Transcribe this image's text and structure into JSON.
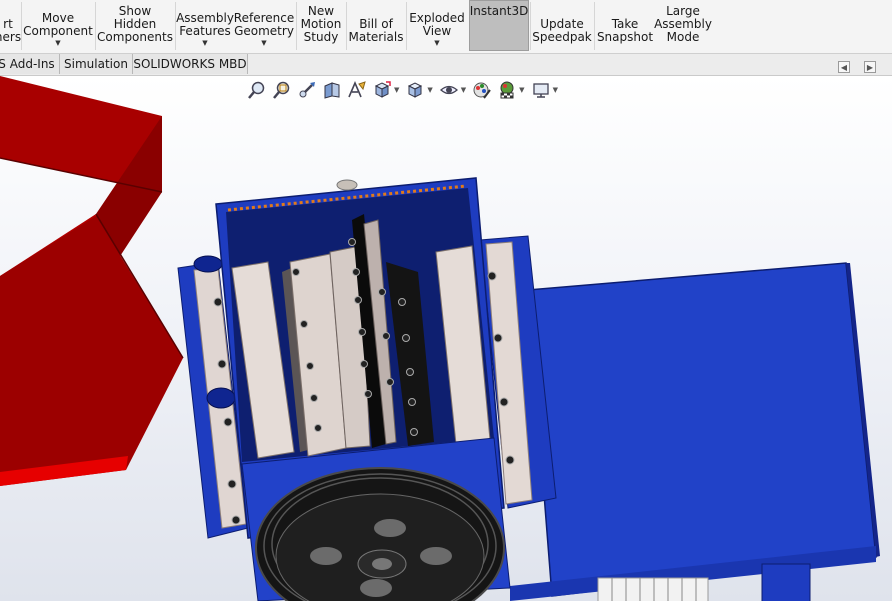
{
  "ribbon": {
    "items": [
      {
        "label_lines": [
          "rt",
          "ners"
        ]
      },
      {
        "label_lines": [
          "Move",
          "Component"
        ],
        "dropdown": true
      },
      {
        "label_lines": [
          "Show",
          "Hidden",
          "Components"
        ]
      },
      {
        "label_lines": [
          "Assembly",
          "Features"
        ],
        "dropdown": true
      },
      {
        "label_lines": [
          "Reference",
          "Geometry"
        ],
        "dropdown": true
      },
      {
        "label_lines": [
          "New",
          "Motion",
          "Study"
        ]
      },
      {
        "label_lines": [
          "Bill of",
          "Materials"
        ]
      },
      {
        "label_lines": [
          "Exploded",
          "View"
        ],
        "dropdown": true
      },
      {
        "label_lines": [
          "Instant3D"
        ],
        "active": true
      },
      {
        "label_lines": [
          "Update",
          "Speedpak"
        ]
      },
      {
        "label_lines": [
          "Take",
          "Snapshot"
        ]
      },
      {
        "label_lines": [
          "Large",
          "Assembly",
          "Mode"
        ]
      }
    ]
  },
  "tabs": [
    "S Add-Ins",
    "Simulation",
    "SOLIDWORKS MBD"
  ],
  "hud_icons": [
    "zoom-to-fit-icon",
    "zoom-to-area-icon",
    "previous-view-icon",
    "section-view-icon",
    "dynamic-annotation-views-icon",
    "view-orientation-icon",
    "display-style-icon",
    "hide-show-items-icon",
    "edit-appearance-icon",
    "apply-scene-icon",
    "view-settings-icon"
  ],
  "colors": {
    "frame_blue": "#1e3cc0",
    "hopper_red": "#a80000",
    "accent_orange": "#e07a1a",
    "ribbon_bg": "#f4f4f4",
    "active_button": "#bebebe"
  }
}
